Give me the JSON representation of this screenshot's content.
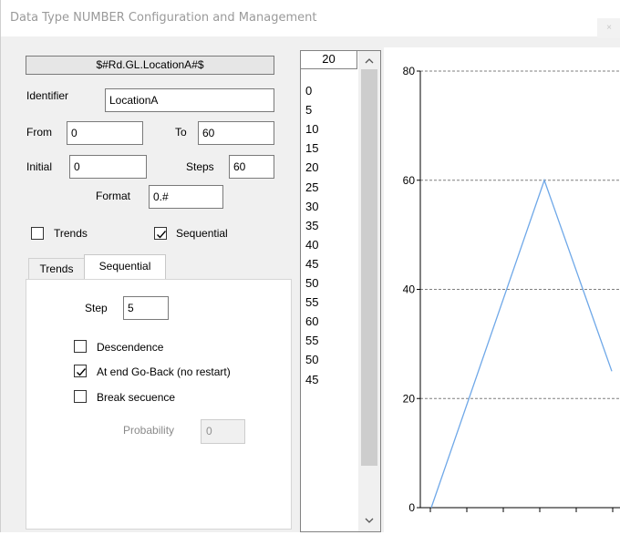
{
  "window": {
    "title": "Data Type NUMBER Configuration and Management",
    "close_glyph": "×"
  },
  "config": {
    "reference": "$#Rd.GL.LocationA#$",
    "identifier_label": "Identifier",
    "identifier_value": "LocationA",
    "from_label": "From",
    "from_value": "0",
    "to_label": "To",
    "to_value": "60",
    "initial_label": "Initial",
    "initial_value": "0",
    "steps_label": "Steps",
    "steps_value": "60",
    "format_label": "Format",
    "format_value": "0.#",
    "trends_label": "Trends",
    "trends_checked": false,
    "sequential_label": "Sequential",
    "sequential_checked": true
  },
  "tabs": [
    {
      "label": "Trends",
      "active": false
    },
    {
      "label": "Sequential",
      "active": true
    }
  ],
  "sequential": {
    "step_label": "Step",
    "step_value": "5",
    "descendence_label": "Descendence",
    "descendence_checked": false,
    "goback_label": "At end Go-Back (no restart)",
    "goback_checked": true,
    "break_label": "Break secuence",
    "break_checked": false,
    "probability_label": "Probability",
    "probability_value": "0"
  },
  "values_list": {
    "header": "20",
    "items": [
      "0",
      "5",
      "10",
      "15",
      "20",
      "25",
      "30",
      "35",
      "40",
      "45",
      "50",
      "55",
      "60",
      "55",
      "50",
      "45"
    ],
    "scroll_up_icon": "chevron-up-icon",
    "scroll_down_icon": "chevron-down-icon"
  },
  "chart_data": {
    "type": "line",
    "title": "",
    "xlabel": "",
    "ylabel": "",
    "ylim": [
      0,
      80
    ],
    "yticks": [
      "0",
      "20",
      "40",
      "60",
      "80"
    ],
    "grid": "horizontal dashed",
    "x": [
      0,
      1,
      2,
      3,
      4,
      5,
      6,
      7,
      8,
      9,
      10,
      11,
      12,
      13,
      14,
      15
    ],
    "series": [
      {
        "values": [
          0,
          5,
          10,
          15,
          20,
          25,
          30,
          35,
          40,
          45,
          50,
          55,
          60,
          55,
          50,
          45
        ],
        "color": "#6fa8e8"
      }
    ],
    "visible_y_range_end": 25,
    "axis_color": "#000000",
    "grid_color": "#7f7f7f"
  }
}
